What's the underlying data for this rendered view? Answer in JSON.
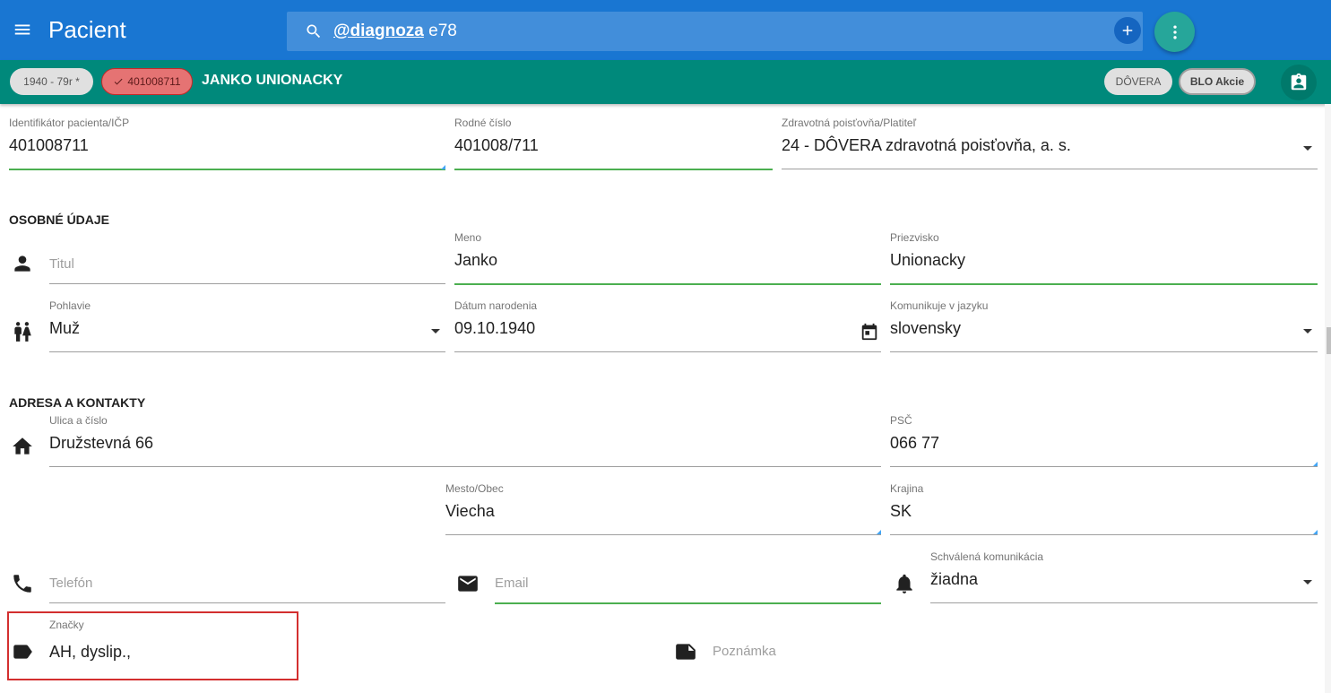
{
  "appbar": {
    "title": "Pacient",
    "search_token": "@diagnoza",
    "search_query": "e78"
  },
  "patient": {
    "age_chip": "1940 - 79r *",
    "id_chip": "401008711",
    "name": "JANKO UNIONACKY",
    "insurer_chip": "DÔVERA",
    "actions_chip": "BLO Akcie"
  },
  "ids": {
    "icp_label": "Identifikátor pacienta/IČP",
    "icp_value": "401008711",
    "rc_label": "Rodné číslo",
    "rc_value": "401008/711",
    "insurer_label": "Zdravotná poisťovňa/Platiteľ",
    "insurer_value": "24 - DÔVERA zdravotná poisťovňa, a. s."
  },
  "personal": {
    "section_title": "OSOBNÉ ÚDAJE",
    "title_placeholder": "Titul",
    "first_name_label": "Meno",
    "first_name_value": "Janko",
    "last_name_label": "Priezvisko",
    "last_name_value": "Unionacky",
    "gender_label": "Pohlavie",
    "gender_value": "Muž",
    "birth_label": "Dátum narodenia",
    "birth_value": "09.10.1940",
    "language_label": "Komunikuje v jazyku",
    "language_value": "slovensky"
  },
  "address": {
    "section_title": "ADRESA A KONTAKTY",
    "street_label": "Ulica a číslo",
    "street_value": "Družstevná 66",
    "zip_label": "PSČ",
    "zip_value": "066 77",
    "city_label": "Mesto/Obec",
    "city_value": "Viecha",
    "country_label": "Krajina",
    "country_value": "SK",
    "phone_placeholder": "Telefón",
    "email_placeholder": "Email",
    "approved_label": "Schválená komunikácia",
    "approved_value": "žiadna",
    "tags_label": "Značky",
    "tags_value": "AH, dyslip.,",
    "note_placeholder": "Poznámka"
  },
  "colors": {
    "appbar": "#1976d2",
    "patientbar": "#00897b",
    "active_line": "#4caf50",
    "highlight_box": "#d32f2f"
  }
}
